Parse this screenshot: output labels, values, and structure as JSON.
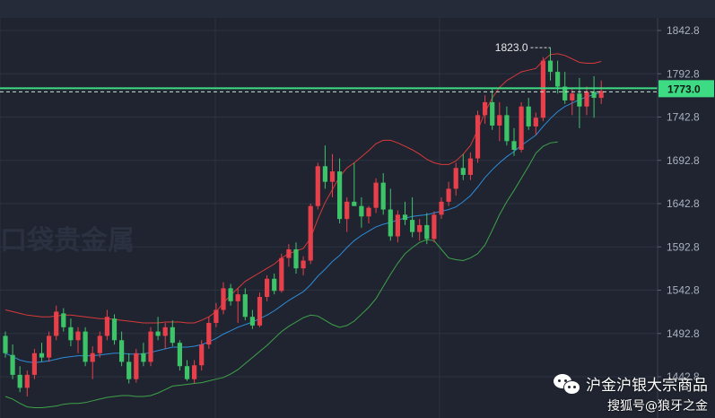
{
  "chart_data": {
    "type": "candlestick",
    "title": "",
    "xlabel": "",
    "ylabel": "",
    "ylim": [
      1418,
      1852
    ],
    "y_ticks": [
      "1842.8",
      "1792.8",
      "1742.8",
      "1692.8",
      "1642.8",
      "1592.8",
      "1542.8",
      "1492.8",
      "1442.8"
    ],
    "last_price_label": "1773.0",
    "last_price": 1773.0,
    "peak_label": "1823.0",
    "peak_value": 1823.0,
    "grid": true,
    "colors": {
      "background": "#1f2430",
      "up": "#e8404a",
      "down": "#3ec468",
      "mid_band": "#2f8bd6",
      "upper_band": "#d83a3a",
      "lower_band": "#3fa34a",
      "price_line": "#3ddc84",
      "grid": "#2c3240"
    },
    "candles": [
      [
        1490,
        1495,
        1465,
        1470
      ],
      [
        1468,
        1480,
        1440,
        1445
      ],
      [
        1445,
        1455,
        1425,
        1430
      ],
      [
        1430,
        1450,
        1420,
        1445
      ],
      [
        1445,
        1475,
        1440,
        1470
      ],
      [
        1470,
        1482,
        1460,
        1465
      ],
      [
        1465,
        1495,
        1460,
        1490
      ],
      [
        1490,
        1525,
        1485,
        1518
      ],
      [
        1516,
        1522,
        1495,
        1500
      ],
      [
        1500,
        1510,
        1478,
        1485
      ],
      [
        1485,
        1500,
        1470,
        1495
      ],
      [
        1495,
        1500,
        1455,
        1460
      ],
      [
        1460,
        1478,
        1440,
        1470
      ],
      [
        1470,
        1495,
        1465,
        1490
      ],
      [
        1490,
        1520,
        1485,
        1512
      ],
      [
        1510,
        1515,
        1480,
        1485
      ],
      [
        1485,
        1495,
        1455,
        1460
      ],
      [
        1460,
        1470,
        1435,
        1440
      ],
      [
        1440,
        1475,
        1436,
        1470
      ],
      [
        1470,
        1482,
        1455,
        1460
      ],
      [
        1460,
        1500,
        1455,
        1495
      ],
      [
        1495,
        1512,
        1485,
        1490
      ],
      [
        1490,
        1505,
        1475,
        1500
      ],
      [
        1500,
        1508,
        1478,
        1482
      ],
      [
        1482,
        1485,
        1450,
        1455
      ],
      [
        1455,
        1462,
        1438,
        1440
      ],
      [
        1440,
        1462,
        1435,
        1456
      ],
      [
        1456,
        1485,
        1450,
        1480
      ],
      [
        1480,
        1512,
        1475,
        1505
      ],
      [
        1505,
        1528,
        1500,
        1520
      ],
      [
        1520,
        1552,
        1515,
        1545
      ],
      [
        1545,
        1550,
        1525,
        1530
      ],
      [
        1530,
        1545,
        1505,
        1538
      ],
      [
        1538,
        1545,
        1508,
        1512
      ],
      [
        1512,
        1520,
        1498,
        1502
      ],
      [
        1502,
        1540,
        1500,
        1535
      ],
      [
        1535,
        1560,
        1530,
        1556
      ],
      [
        1556,
        1562,
        1538,
        1542
      ],
      [
        1542,
        1585,
        1540,
        1580
      ],
      [
        1580,
        1596,
        1570,
        1590
      ],
      [
        1590,
        1598,
        1562,
        1568
      ],
      [
        1568,
        1582,
        1560,
        1577
      ],
      [
        1577,
        1643,
        1573,
        1640
      ],
      [
        1640,
        1690,
        1636,
        1686
      ],
      [
        1686,
        1710,
        1660,
        1668
      ],
      [
        1668,
        1700,
        1650,
        1680
      ],
      [
        1680,
        1695,
        1620,
        1625
      ],
      [
        1625,
        1650,
        1610,
        1645
      ],
      [
        1645,
        1690,
        1640,
        1640
      ],
      [
        1640,
        1650,
        1615,
        1628
      ],
      [
        1628,
        1640,
        1620,
        1638
      ],
      [
        1638,
        1672,
        1632,
        1667
      ],
      [
        1667,
        1678,
        1630,
        1636
      ],
      [
        1636,
        1660,
        1600,
        1605
      ],
      [
        1605,
        1635,
        1598,
        1630
      ],
      [
        1630,
        1645,
        1618,
        1624
      ],
      [
        1624,
        1650,
        1604,
        1610
      ],
      [
        1610,
        1625,
        1600,
        1618
      ],
      [
        1618,
        1632,
        1596,
        1602
      ],
      [
        1602,
        1634,
        1598,
        1630
      ],
      [
        1630,
        1650,
        1625,
        1645
      ],
      [
        1645,
        1668,
        1640,
        1660
      ],
      [
        1660,
        1690,
        1652,
        1684
      ],
      [
        1684,
        1700,
        1670,
        1676
      ],
      [
        1676,
        1702,
        1670,
        1695
      ],
      [
        1695,
        1750,
        1690,
        1745
      ],
      [
        1745,
        1768,
        1735,
        1760
      ],
      [
        1760,
        1775,
        1728,
        1733
      ],
      [
        1733,
        1760,
        1715,
        1745
      ],
      [
        1745,
        1755,
        1710,
        1715
      ],
      [
        1715,
        1730,
        1698,
        1705
      ],
      [
        1705,
        1760,
        1702,
        1755
      ],
      [
        1755,
        1765,
        1728,
        1732
      ],
      [
        1732,
        1748,
        1722,
        1742
      ],
      [
        1742,
        1812,
        1738,
        1808
      ],
      [
        1808,
        1823,
        1785,
        1795
      ],
      [
        1795,
        1808,
        1770,
        1778
      ],
      [
        1778,
        1795,
        1758,
        1762
      ],
      [
        1762,
        1775,
        1745,
        1770
      ],
      [
        1770,
        1788,
        1730,
        1755
      ],
      [
        1755,
        1778,
        1745,
        1772
      ],
      [
        1772,
        1790,
        1742,
        1765
      ],
      [
        1765,
        1785,
        1758,
        1773
      ]
    ],
    "mid_band": [
      1470,
      1466,
      1462,
      1460,
      1459,
      1460,
      1461,
      1463,
      1465,
      1466,
      1467,
      1467,
      1467,
      1468,
      1469,
      1470,
      1470,
      1469,
      1469,
      1469,
      1471,
      1473,
      1475,
      1477,
      1477,
      1477,
      1478,
      1480,
      1483,
      1487,
      1492,
      1496,
      1500,
      1503,
      1506,
      1510,
      1514,
      1519,
      1525,
      1531,
      1536,
      1541,
      1549,
      1559,
      1567,
      1576,
      1583,
      1592,
      1600,
      1606,
      1611,
      1616,
      1619,
      1621,
      1624,
      1626,
      1628,
      1629,
      1630,
      1632,
      1634,
      1636,
      1639,
      1645,
      1652,
      1662,
      1673,
      1682,
      1690,
      1697,
      1703,
      1710,
      1716,
      1722,
      1732,
      1741,
      1749,
      1755,
      1759,
      1763,
      1766,
      1769,
      1771
    ],
    "upper_band": [
      1520,
      1518,
      1516,
      1514,
      1513,
      1512,
      1512,
      1513,
      1514,
      1514,
      1513,
      1512,
      1511,
      1510,
      1510,
      1509,
      1508,
      1507,
      1506,
      1505,
      1505,
      1505,
      1506,
      1506,
      1506,
      1505,
      1505,
      1508,
      1512,
      1518,
      1528,
      1537,
      1545,
      1553,
      1558,
      1563,
      1568,
      1573,
      1580,
      1585,
      1588,
      1591,
      1603,
      1625,
      1644,
      1659,
      1674,
      1684,
      1690,
      1697,
      1704,
      1712,
      1716,
      1716,
      1713,
      1709,
      1705,
      1700,
      1694,
      1690,
      1688,
      1688,
      1692,
      1700,
      1710,
      1728,
      1748,
      1765,
      1777,
      1785,
      1790,
      1795,
      1797,
      1799,
      1808,
      1815,
      1816,
      1814,
      1810,
      1806,
      1805,
      1805,
      1807
    ],
    "lower_band": [
      1420,
      1417,
      1412,
      1408,
      1407,
      1407,
      1408,
      1409,
      1411,
      1412,
      1412,
      1413,
      1415,
      1417,
      1419,
      1420,
      1421,
      1421,
      1420,
      1420,
      1421,
      1424,
      1428,
      1432,
      1433,
      1434,
      1435,
      1436,
      1438,
      1440,
      1442,
      1446,
      1451,
      1458,
      1465,
      1472,
      1479,
      1487,
      1495,
      1501,
      1506,
      1511,
      1514,
      1513,
      1508,
      1503,
      1500,
      1502,
      1507,
      1515,
      1523,
      1533,
      1547,
      1561,
      1574,
      1585,
      1592,
      1598,
      1601,
      1600,
      1590,
      1580,
      1578,
      1577,
      1580,
      1585,
      1595,
      1612,
      1630,
      1645,
      1658,
      1672,
      1686,
      1701,
      1709,
      1713,
      1714
    ]
  },
  "watermark": "口袋贵金属",
  "wechat": {
    "line1": "沪金沪银大宗商品",
    "line2": "搜狐号@狼牙之金"
  }
}
